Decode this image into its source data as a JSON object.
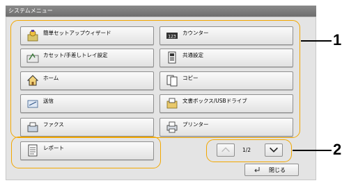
{
  "window": {
    "title": "システムメニュー"
  },
  "menu": {
    "left": [
      {
        "label": "簡単セットアップウィザード",
        "icon": "wizard-icon"
      },
      {
        "label": "カセット/手差しトレイ設定",
        "icon": "cassette-icon"
      },
      {
        "label": "ホーム",
        "icon": "home-icon"
      },
      {
        "label": "送信",
        "icon": "send-icon"
      },
      {
        "label": "ファクス",
        "icon": "fax-icon"
      },
      {
        "label": "レポート",
        "icon": "report-icon"
      }
    ],
    "right": [
      {
        "label": "カウンター",
        "icon": "counter-icon"
      },
      {
        "label": "共通設定",
        "icon": "common-settings-icon"
      },
      {
        "label": "コピー",
        "icon": "copy-icon"
      },
      {
        "label": "文書ボックス/USBドライブ",
        "icon": "document-box-icon"
      },
      {
        "label": "プリンター",
        "icon": "printer-icon"
      }
    ]
  },
  "pager": {
    "text": "1/2"
  },
  "close": {
    "label": "閉じる"
  },
  "callouts": {
    "one": "1",
    "two": "2"
  },
  "colors": {
    "highlight": "#f2a700"
  }
}
